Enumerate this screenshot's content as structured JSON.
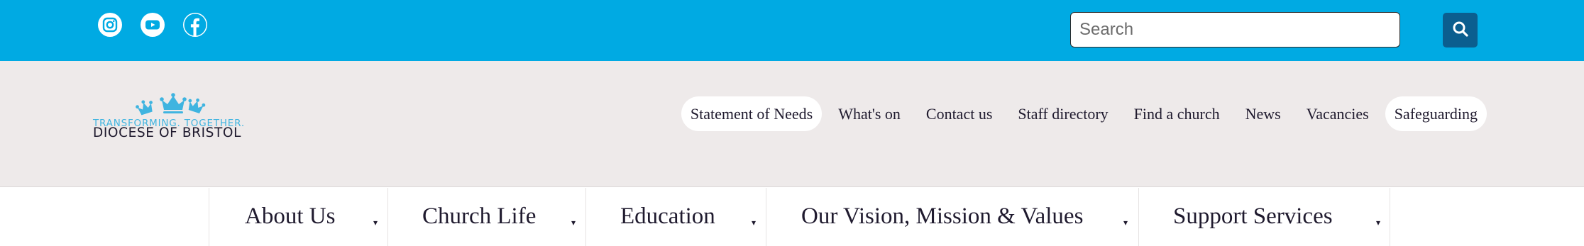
{
  "topbar": {
    "social": [
      {
        "name": "instagram-icon"
      },
      {
        "name": "youtube-icon"
      },
      {
        "name": "facebook-icon"
      }
    ],
    "search": {
      "placeholder": "Search",
      "value": ""
    },
    "search_button_icon": "search-icon"
  },
  "logo": {
    "name": "DIOCESE OF BRISTOL",
    "tagline": "TRANSFORMING. TOGETHER."
  },
  "utility_nav": [
    {
      "label": "Statement of Needs",
      "highlighted": true
    },
    {
      "label": "What's on",
      "highlighted": false
    },
    {
      "label": "Contact us",
      "highlighted": false
    },
    {
      "label": "Staff directory",
      "highlighted": false
    },
    {
      "label": "Find a church",
      "highlighted": false
    },
    {
      "label": "News",
      "highlighted": false
    },
    {
      "label": "Vacancies",
      "highlighted": false
    },
    {
      "label": "Safeguarding",
      "highlighted": true
    }
  ],
  "main_nav": [
    {
      "label": "About Us",
      "caret": "▾"
    },
    {
      "label": "Church Life",
      "caret": "▾"
    },
    {
      "label": "Education",
      "caret": "▾"
    },
    {
      "label": "Our Vision, Mission & Values",
      "caret": "▾"
    },
    {
      "label": "Support Services",
      "caret": "▾"
    }
  ],
  "colors": {
    "topbar": "#00aae3",
    "search_button": "#0b5e8f",
    "header_bg": "#eeeaea",
    "text_dark": "#1f1a2e",
    "logo_blue": "#3fb4e0"
  }
}
